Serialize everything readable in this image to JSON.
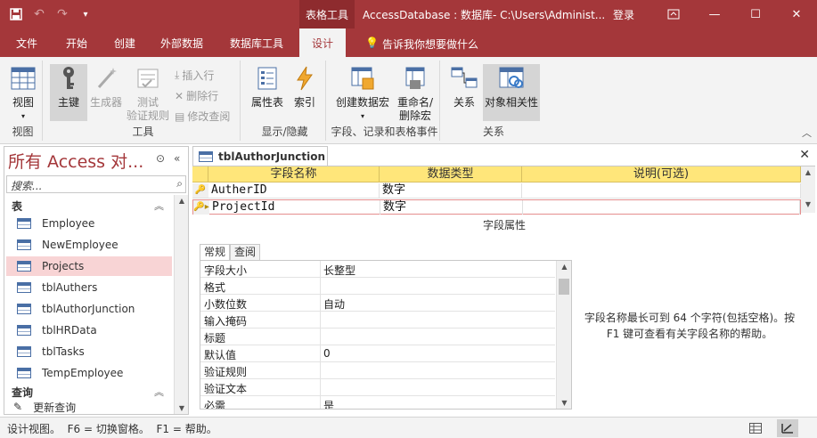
{
  "window": {
    "context_tab": "表格工具",
    "title": "AccessDatabase : 数据库- C:\\Users\\Administ...",
    "login": "登录",
    "minimize": "—",
    "maximize": "☐",
    "close": "✕"
  },
  "qat": {
    "save": "💾",
    "undo": "↶",
    "redo": "↷",
    "more": "▾"
  },
  "tabs": [
    {
      "label": "文件"
    },
    {
      "label": "开始"
    },
    {
      "label": "创建"
    },
    {
      "label": "外部数据"
    },
    {
      "label": "数据库工具"
    },
    {
      "label": "设计"
    }
  ],
  "tellme": "告诉我你想要做什么",
  "ribbon": {
    "view_group": {
      "label": "视图",
      "view_btn": "视图"
    },
    "tools_group": {
      "label": "工具",
      "primary_key": "主键",
      "builder": "生成器",
      "test_rules_1": "测试",
      "test_rules_2": "验证规则",
      "insert_rows": "插入行",
      "delete_rows": "删除行",
      "modify_lookups": "修改查阅"
    },
    "showhide_group": {
      "label": "显示/隐藏",
      "property_sheet": "属性表",
      "indexes": "索引"
    },
    "events_group": {
      "label": "字段、记录和表格事件",
      "create_macros_1": "创建数据宏",
      "rename_macro_1": "重命名/",
      "rename_macro_2": "删除宏"
    },
    "relationships_group": {
      "label": "关系",
      "relationships": "关系",
      "dependencies": "对象相关性"
    }
  },
  "nav": {
    "title": "所有 Access 对...",
    "search_placeholder": "搜索...",
    "section_tables": "表",
    "section_queries": "查询",
    "tables": [
      "Employee",
      "NewEmployee",
      "Projects",
      "tblAuthers",
      "tblAuthorJunction",
      "tblHRData",
      "tblTasks",
      "TempEmployee"
    ],
    "selected_table": "Projects",
    "query_first": "更新查询"
  },
  "document": {
    "tab_title": "tblAuthorJunction",
    "columns": {
      "field_name": "字段名称",
      "data_type": "数据类型",
      "description": "说明(可选)"
    },
    "rows": [
      {
        "field": "AutherID",
        "type": "数字",
        "desc": ""
      },
      {
        "field": "ProjectId",
        "type": "数字",
        "desc": ""
      }
    ],
    "field_properties_title": "字段属性",
    "prop_tabs": {
      "general": "常规",
      "lookup": "查阅"
    },
    "properties": [
      {
        "name": "字段大小",
        "value": "长整型"
      },
      {
        "name": "格式",
        "value": ""
      },
      {
        "name": "小数位数",
        "value": "自动"
      },
      {
        "name": "输入掩码",
        "value": ""
      },
      {
        "name": "标题",
        "value": ""
      },
      {
        "name": "默认值",
        "value": "0"
      },
      {
        "name": "验证规则",
        "value": ""
      },
      {
        "name": "验证文本",
        "value": ""
      },
      {
        "name": "必需",
        "value": "是"
      }
    ],
    "help_text": "字段名称最长可到 64 个字符(包括空格)。按 F1 键可查看有关字段名称的帮助。"
  },
  "status": {
    "text": "设计视图。  F6 = 切换窗格。  F1 = 帮助。"
  },
  "colors": {
    "accent": "#a4373a",
    "header_yellow": "#ffe67a",
    "selected_nav": "#f8d4d5"
  }
}
